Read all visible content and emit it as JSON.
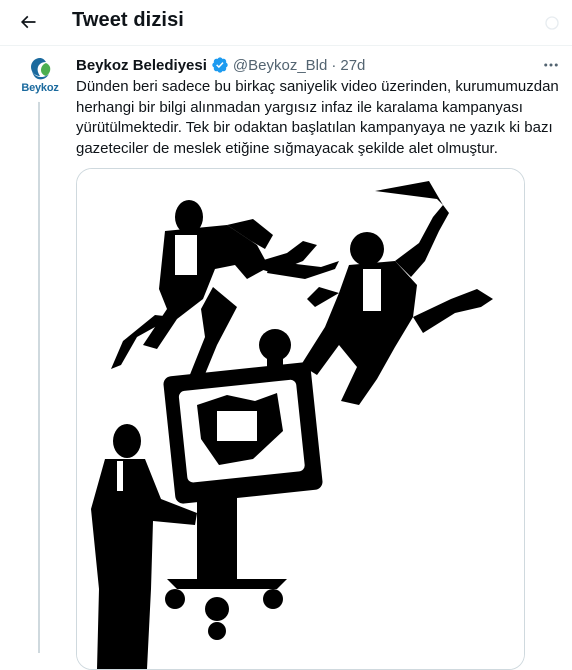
{
  "header": {
    "title": "Tweet dizisi",
    "back_icon": "arrow-left-icon"
  },
  "tweet": {
    "author_name": "Beykoz Belediyesi",
    "handle": "@Beykoz_Bld",
    "separator": "·",
    "time": "27d",
    "verified_icon": "verified-badge-icon",
    "more_icon": "more-horizontal-icon",
    "avatar_text": "Beykoz",
    "text": "Dünden beri sadece bu birkaç saniyelik video üzerinden, kurumumuzdan herhangi bir bilgi alınmadan yargısız infaz ile karalama kampanyası yürütülmektedir. Tek bir odaktan başlatılan kampanyaya ne yazık ki bazı gazeteciler de meslek etiğine sığmayacak şekilde alet olmuştur.",
    "media_icon": "illustration-image"
  },
  "colors": {
    "text": "#0f1419",
    "secondary": "#536471",
    "verified": "#1d9bf0",
    "border": "#cfd9de",
    "avatar_logo": "#1b6a9e"
  }
}
